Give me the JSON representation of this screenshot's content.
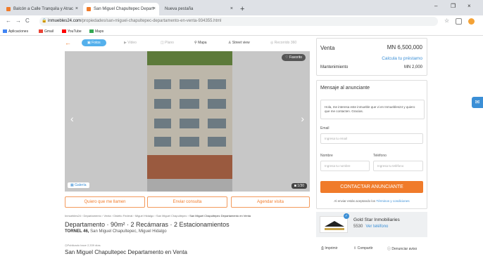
{
  "browser": {
    "tabs": [
      {
        "label": "Balcón a Calle Tranquila y Atrac",
        "close": "×"
      },
      {
        "label": "San Miguel Chapultepec Depart",
        "close": "×"
      },
      {
        "label": "Nueva pestaña",
        "close": "×"
      }
    ],
    "new_tab": "+",
    "window_controls": [
      "–",
      "❐",
      "×"
    ],
    "url_domain": "inmuebles24.com",
    "url_path": "/propiedades/san-miguel-chapultepec-departamento-en-venta-934355.html",
    "bookmarks": [
      {
        "label": "Aplicaciones",
        "icon": "apps-icon",
        "color": "#4285f4"
      },
      {
        "label": "Gmail",
        "icon": "gmail-icon",
        "color": "#ea4335"
      },
      {
        "label": "YouTube",
        "icon": "youtube-icon",
        "color": "#ff0000"
      },
      {
        "label": "Maps",
        "icon": "maps-icon",
        "color": "#34a853"
      }
    ]
  },
  "gallery": {
    "tabs": [
      "Fotos",
      "Video",
      "Plano",
      "Mapa",
      "Street view",
      "Recorrido 360"
    ],
    "favorite": "Favorito",
    "gallery_label": "Galería",
    "counter": "1/30"
  },
  "actions": {
    "call": "Quiero que me llamen",
    "send": "Enviar consulta",
    "visit": "Agendar visita"
  },
  "listing": {
    "breadcrumbs": [
      "Inmuebles24",
      "Departamento",
      "Venta",
      "Distrito Federal",
      "Miguel Hidalgo",
      "San Miguel Chapultepec"
    ],
    "breadcrumb_current": "San Miguel Chapultepec Departamento en Venta",
    "title": "Departamento · 90m² · 2 Recámaras · 2 Estacionamientos",
    "address_street": "TORNEL 46,",
    "address_area": "San Miguel Chapultepec, Miguel Hidalgo",
    "published": "Publicado hace 2,339 días",
    "subtitle": "San Miguel Chapultepec Departamento en Venta"
  },
  "price": {
    "operation": "Venta",
    "amount": "MN 6,500,000",
    "calc_link": "Calcula tu préstamo",
    "maintenance_label": "Mantenimiento",
    "maintenance_value": "MN 2,000"
  },
  "contact": {
    "title": "Mensaje al anunciante",
    "message": "Hola, me interesa este inmueble que vi en Inmuebles24 y quiero que me contacten. Gracias.",
    "email_label": "Email",
    "email_placeholder": "Ingresa tu email",
    "name_label": "Nombre",
    "name_placeholder": "Ingresa tu nombre",
    "phone_label": "Teléfono",
    "phone_placeholder": "Ingresa tu teléfono",
    "cta": "CONTACTAR ANUNCIANTE",
    "terms_prefix": "Al enviar estás aceptando los",
    "terms_link": "Términos y condiciones"
  },
  "agent": {
    "name": "Gold Star Inmobiliaries",
    "phone_partial": "5530",
    "phone_link": "Ver teléfono"
  },
  "tools": {
    "print": "Imprimir",
    "share": "Compartir",
    "report": "Denunciar aviso"
  },
  "colors": {
    "accent": "#f07b2a",
    "link": "#3b8fd6",
    "tab_active": "#54b0ec"
  }
}
